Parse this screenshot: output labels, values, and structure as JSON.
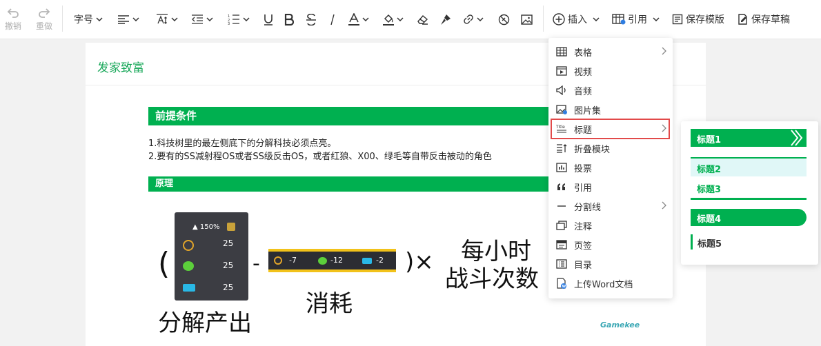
{
  "toolbar": {
    "undo": "撤销",
    "redo": "重做",
    "font_size": "字号",
    "insert": "插入",
    "quote": "引用",
    "save_template": "保存模版",
    "save_draft": "保存草稿"
  },
  "document": {
    "title": "发家致富",
    "section1": "前提条件",
    "line1": "1.科技树里的最左侧底下的分解科技必须点亮。",
    "line2": "2.要有的SS减射程OS或者SS级反击OS，或者红狼、X00、绿毛等自带反击被动的角色",
    "section2": "原理",
    "formula": {
      "open_paren": "(",
      "minus": "-",
      "times": ")×",
      "percent": "▲ 150%",
      "produce_values": [
        "25",
        "25",
        "25"
      ],
      "cost_values": [
        "-7",
        "-12",
        "-2"
      ],
      "left_caption": "分解产出",
      "middle_caption": "消耗",
      "right_caption_1": "每小时",
      "right_caption_2": "战斗次数"
    },
    "watermark": "Gamekee"
  },
  "insert_menu": {
    "items": [
      {
        "label": "表格",
        "icon": "table-icon"
      },
      {
        "label": "视频",
        "icon": "video-icon"
      },
      {
        "label": "音频",
        "icon": "audio-icon"
      },
      {
        "label": "图片集",
        "icon": "gallery-icon"
      },
      {
        "label": "标题",
        "icon": "title-icon"
      },
      {
        "label": "折叠模块",
        "icon": "fold-icon"
      },
      {
        "label": "投票",
        "icon": "vote-icon"
      },
      {
        "label": "引用",
        "icon": "quote-icon"
      },
      {
        "label": "分割线",
        "icon": "divider-icon"
      },
      {
        "label": "注释",
        "icon": "note-icon"
      },
      {
        "label": "页签",
        "icon": "tabs-icon"
      },
      {
        "label": "目录",
        "icon": "toc-icon"
      },
      {
        "label": "上传Word文档",
        "icon": "word-icon"
      }
    ]
  },
  "heading_menu": {
    "items": [
      "标题1",
      "标题2",
      "标题3",
      "标题4",
      "标题5"
    ]
  },
  "colors": {
    "accent": "#00b050",
    "highlight_border": "#e24a4a"
  }
}
